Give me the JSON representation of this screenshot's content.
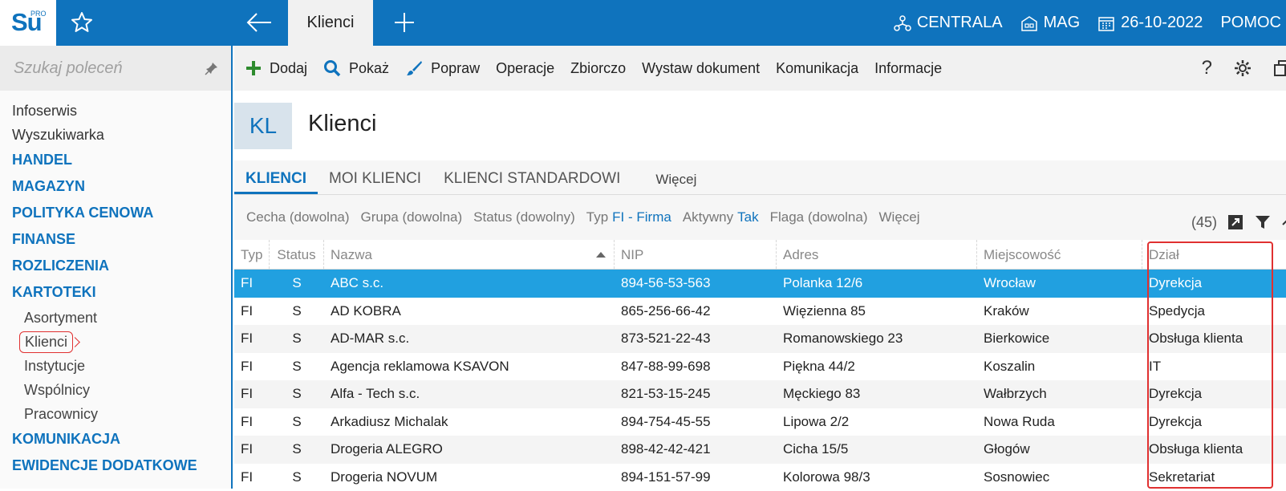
{
  "topbar": {
    "logo_text": "Su",
    "logo_sup": "PRO",
    "active_tab": "Klienci",
    "right": [
      {
        "icon": "network-icon",
        "label": "CENTRALA"
      },
      {
        "icon": "warehouse-icon",
        "label": "MAG"
      },
      {
        "icon": "calendar-icon",
        "label": "26-10-2022"
      },
      {
        "icon": "",
        "label": "POMOC"
      }
    ]
  },
  "sidebar": {
    "search_placeholder": "Szukaj poleceń",
    "plain_items": [
      "Infoserwis",
      "Wyszukiwarka"
    ],
    "sections_top": [
      "HANDEL",
      "MAGAZYN",
      "POLITYKA CENOWA",
      "FINANSE",
      "ROZLICZENIA",
      "KARTOTEKI"
    ],
    "sub_items": [
      "Asortyment",
      "Klienci",
      "Instytucje",
      "Wspólnicy",
      "Pracownicy"
    ],
    "selected_sub": "Klienci",
    "sections_bottom": [
      "KOMUNIKACJA",
      "EWIDENCJE DODATKOWE"
    ]
  },
  "toolbar": {
    "items": [
      {
        "icon": "plus-icon",
        "label": "Dodaj"
      },
      {
        "icon": "search-icon",
        "label": "Pokaż"
      },
      {
        "icon": "brush-icon",
        "label": "Popraw"
      },
      {
        "icon": "",
        "label": "Operacje"
      },
      {
        "icon": "",
        "label": "Zbiorczo"
      },
      {
        "icon": "",
        "label": "Wystaw dokument"
      },
      {
        "icon": "",
        "label": "Komunikacja"
      },
      {
        "icon": "",
        "label": "Informacje"
      }
    ],
    "help": "?"
  },
  "header": {
    "badge": "KL",
    "title": "Klienci"
  },
  "tabs": [
    {
      "label": "KLIENCI",
      "active": true
    },
    {
      "label": "MOI KLIENCI",
      "active": false
    },
    {
      "label": "KLIENCI STANDARDOWI",
      "active": false
    }
  ],
  "tabs_more": "Więcej",
  "filters": {
    "cecha": "Cecha (dowolna)",
    "grupa": "Grupa (dowolna)",
    "status": "Status (dowolny)",
    "typ_label": "Typ",
    "typ_value": "FI - Firma",
    "aktywny_label": "Aktywny",
    "aktywny_value": "Tak",
    "flaga": "Flaga (dowolna)",
    "more": "Więcej",
    "count": "(45)"
  },
  "table": {
    "columns": [
      "Typ",
      "Status",
      "Nazwa",
      "NIP",
      "Adres",
      "Miejscowość",
      "Dział"
    ],
    "rows": [
      [
        "FI",
        "S",
        "ABC s.c.",
        "894-56-53-563",
        "Polanka  12/6",
        "Wrocław",
        "Dyrekcja"
      ],
      [
        "FI",
        "S",
        "AD KOBRA",
        "865-256-66-42",
        "Więzienna  85",
        "Kraków",
        "Spedycja"
      ],
      [
        "FI",
        "S",
        "AD-MAR s.c.",
        "873-521-22-43",
        "Romanowskiego 23",
        "Bierkowice",
        "Obsługa klienta"
      ],
      [
        "FI",
        "S",
        "Agencja reklamowa KSAVON",
        "847-88-99-698",
        "Piękna  44/2",
        "Koszalin",
        "IT"
      ],
      [
        "FI",
        "S",
        "Alfa - Tech s.c.",
        "821-53-15-245",
        "Męckiego  83",
        "Wałbrzych",
        "Dyrekcja"
      ],
      [
        "FI",
        "S",
        "Arkadiusz Michalak",
        "894-754-45-55",
        "Lipowa  2/2",
        "Nowa Ruda",
        "Dyrekcja"
      ],
      [
        "FI",
        "S",
        "Drogeria ALEGRO",
        "898-42-42-421",
        "Cicha  15/5",
        "Głogów",
        "Obsługa klienta"
      ],
      [
        "FI",
        "S",
        "Drogeria NOVUM",
        "894-151-57-99",
        "Kolorowa  98/3",
        "Sosnowiec",
        "Sekretariat"
      ]
    ],
    "selected_row": 0
  },
  "colors": {
    "brand": "#0f73bd",
    "selected_row": "#21a0e0",
    "highlight": "#e03030"
  }
}
